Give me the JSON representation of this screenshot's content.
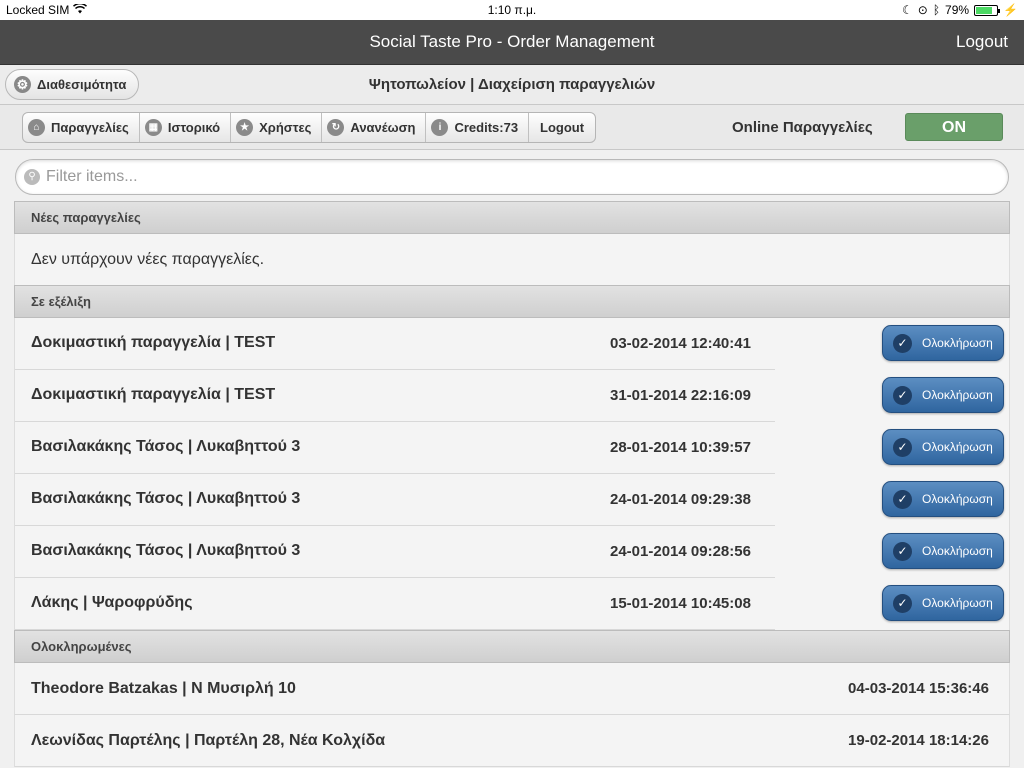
{
  "status_bar": {
    "carrier": "Locked SIM",
    "time": "1:10 π.μ.",
    "battery": "79%",
    "battery_level": 0.79
  },
  "header": {
    "title": "Social Taste Pro - Order Management",
    "logout_label": "Logout"
  },
  "subheader": {
    "availability_label": "Διαθεσιμότητα",
    "page_title": "Ψητοπωλείον | Διαχείριση παραγγελιών"
  },
  "nav": {
    "items": [
      {
        "label": "Παραγγελίες",
        "icon": "home-icon"
      },
      {
        "label": "Ιστορικό",
        "icon": "grid-icon"
      },
      {
        "label": "Χρήστες",
        "icon": "star-icon"
      },
      {
        "label": "Ανανέωση",
        "icon": "refresh-icon"
      },
      {
        "label": "Credits:73",
        "icon": "info-icon"
      }
    ],
    "logout_label": "Logout",
    "online_label": "Online Παραγγελίες",
    "toggle_state": "ON",
    "toggle_color": "#6a9f6a"
  },
  "filter": {
    "placeholder": "Filter items..."
  },
  "sections": {
    "new": {
      "title": "Νέες παραγγελίες",
      "empty_text": "Δεν υπάρχουν νέες παραγγελίες."
    },
    "in_progress": {
      "title": "Σε εξέλιξη",
      "action_label": "Ολοκλήρωση",
      "orders": [
        {
          "name": "Δοκιμαστική παραγγελία | TEST",
          "date": "03-02-2014 12:40:41"
        },
        {
          "name": "Δοκιμαστική παραγγελία | TEST",
          "date": "31-01-2014 22:16:09"
        },
        {
          "name": "Βασιλακάκης Τάσος | Λυκαβηττού 3",
          "date": "28-01-2014 10:39:57"
        },
        {
          "name": "Βασιλακάκης Τάσος | Λυκαβηττού 3",
          "date": "24-01-2014 09:29:38"
        },
        {
          "name": "Βασιλακάκης Τάσος | Λυκαβηττού 3",
          "date": "24-01-2014 09:28:56"
        },
        {
          "name": "Λάκης | Ψαροφρύδης",
          "date": "15-01-2014 10:45:08"
        }
      ]
    },
    "completed": {
      "title": "Ολοκληρωμένες",
      "orders": [
        {
          "name": "Theodore Batzakas | Ν Μυσιρλή 10",
          "date": "04-03-2014 15:36:46"
        },
        {
          "name": "Λεωνίδας Παρτέλης | Παρτέλη 28, Νέα Κολχίδα",
          "date": "19-02-2014 18:14:26"
        }
      ]
    }
  }
}
